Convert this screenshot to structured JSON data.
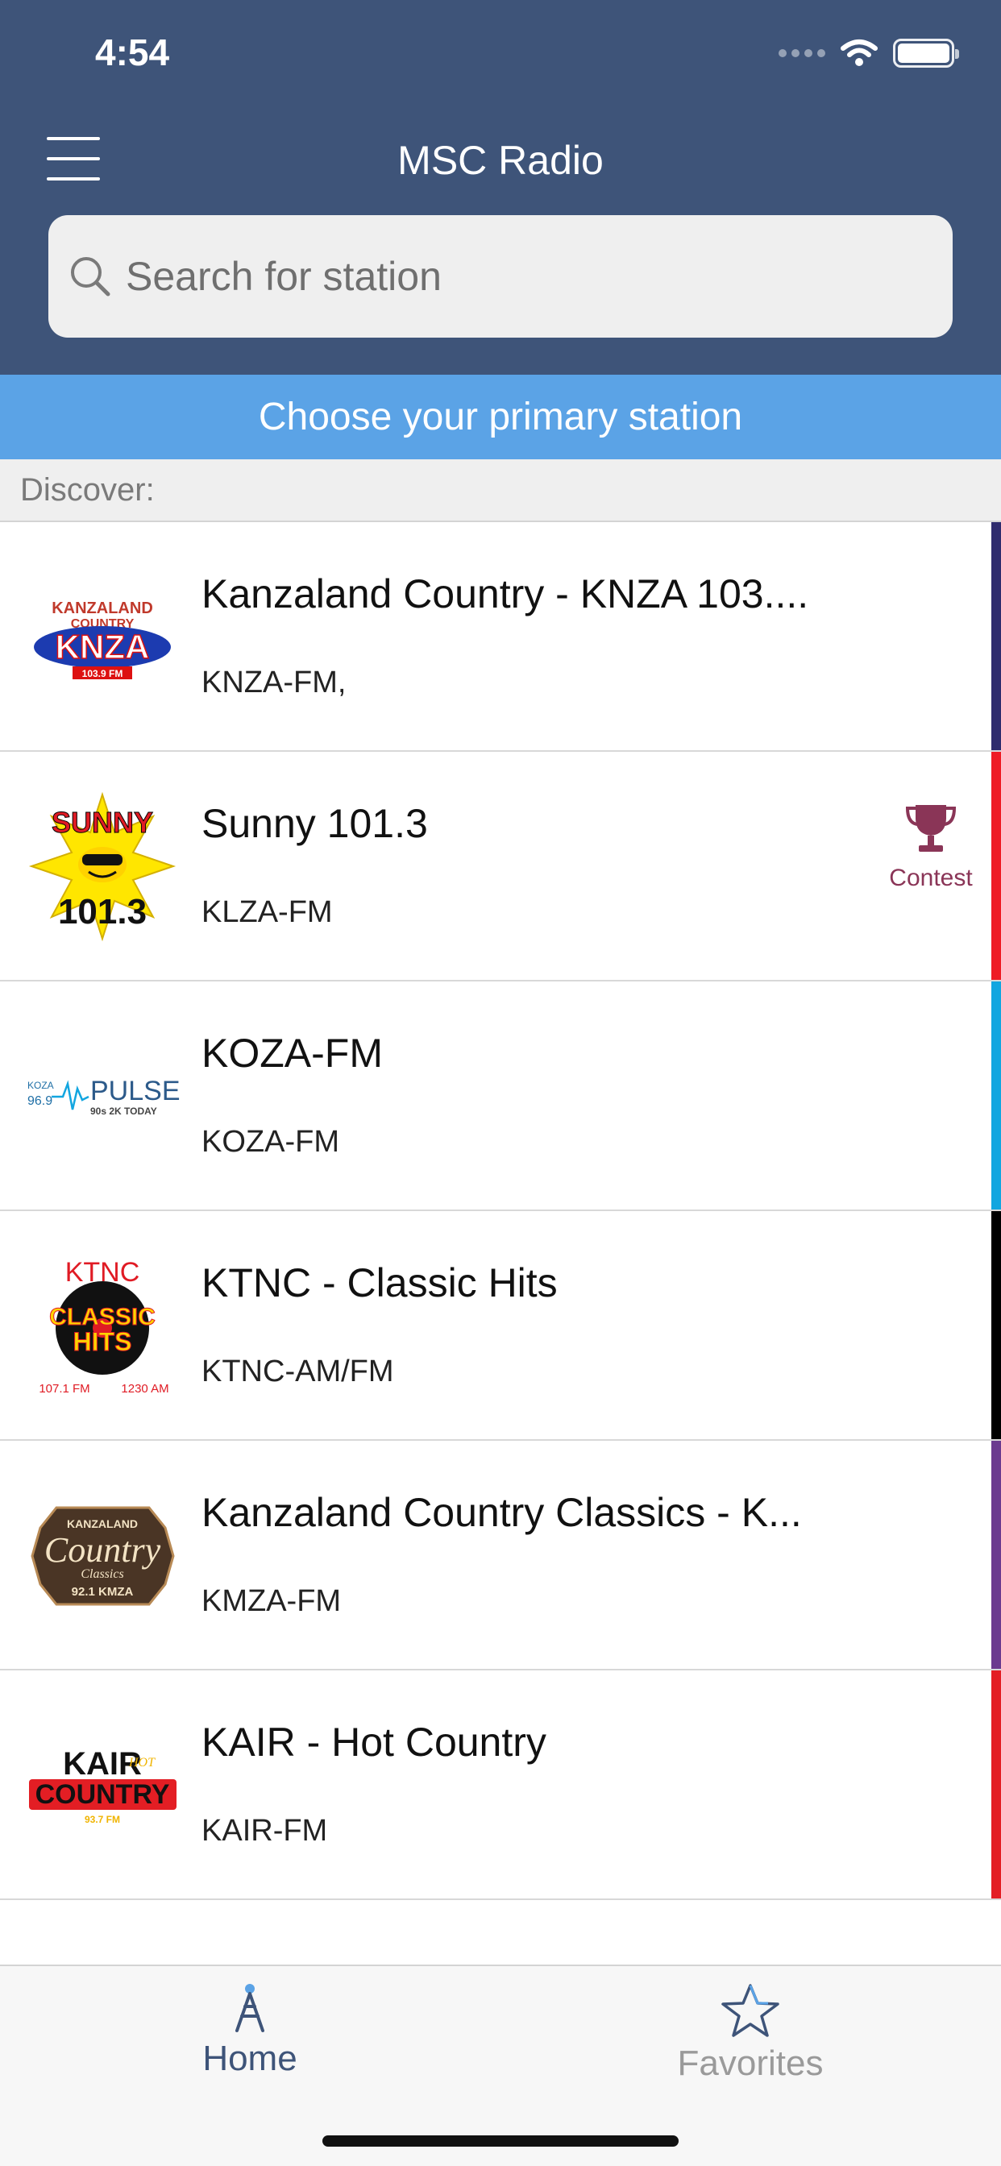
{
  "status_bar": {
    "time": "4:54"
  },
  "header": {
    "title": "MSC Radio"
  },
  "search": {
    "placeholder": "Search for station"
  },
  "banner": {
    "text": "Choose your primary station"
  },
  "section": {
    "label": "Discover:"
  },
  "stations": [
    {
      "name": "Kanzaland Country - KNZA 103....",
      "callsign": "KNZA-FM,",
      "stripe_color": "#2f2c6e",
      "logo_text": [
        "KANZALAND",
        "COUNTRY",
        "KNZA",
        "103.9 FM"
      ]
    },
    {
      "name": "Sunny 101.3",
      "callsign": "KLZA-FM",
      "stripe_color": "#ee1c25",
      "logo_text": [
        "SUNNY",
        "101.3"
      ]
    },
    {
      "name": "KOZA-FM",
      "callsign": "KOZA-FM",
      "stripe_color": "#12a6e0",
      "logo_text": [
        "KOZA",
        "96.9",
        "PULSE",
        "90s 2K TODAY"
      ]
    },
    {
      "name": "KTNC - Classic Hits",
      "callsign": "KTNC-AM/FM",
      "stripe_color": "#000000",
      "logo_text": [
        "KTNC",
        "CLASSIC",
        "HITS",
        "107.1 FM",
        "1230 AM"
      ]
    },
    {
      "name": "Kanzaland Country Classics - K...",
      "callsign": "KMZA-FM",
      "stripe_color": "#6b3a8f",
      "logo_text": [
        "KANZALAND",
        "Country",
        "Classics",
        "92.1 KMZA"
      ]
    },
    {
      "name": "KAIR - Hot Country",
      "callsign": "KAIR-FM",
      "stripe_color": "#e31e24",
      "logo_text": [
        "KAIR",
        "HOT",
        "COUNTRY",
        "93.7 FM"
      ]
    }
  ],
  "contest": {
    "label": "Contest",
    "color": "#8a3557"
  },
  "tabs": {
    "home": {
      "label": "Home",
      "color": "#3e5479"
    },
    "favorites": {
      "label": "Favorites",
      "color": "#9a9a9a"
    }
  }
}
